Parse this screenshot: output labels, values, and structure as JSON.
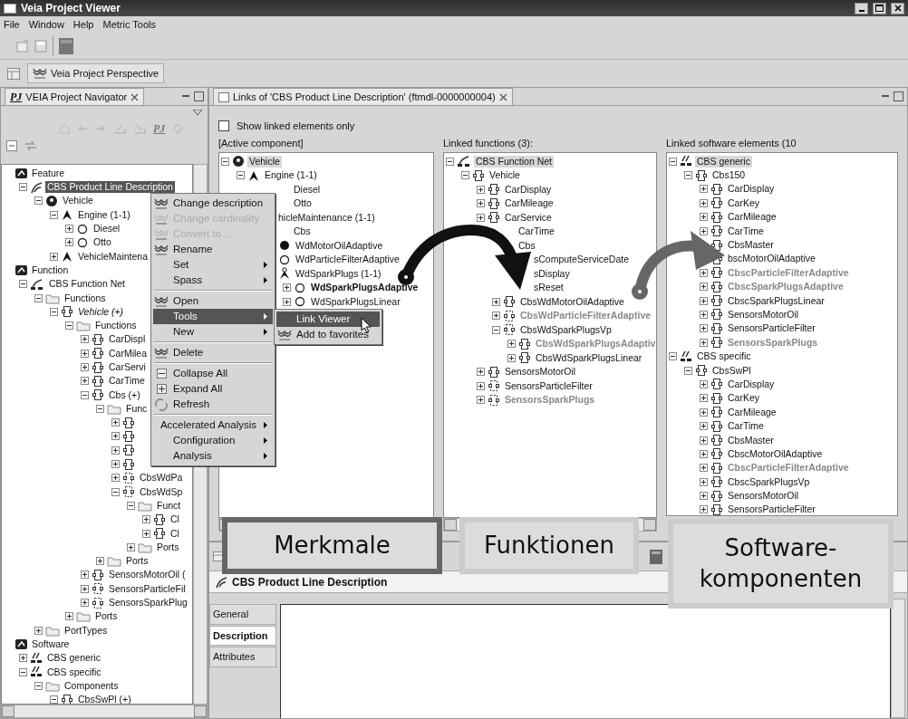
{
  "window": {
    "title": "Veia Project Viewer"
  },
  "menu_bar": [
    "File",
    "Window",
    "Help",
    "Metric Tools"
  ],
  "perspective": {
    "label": "Veia Project Perspective"
  },
  "navigator": {
    "badge": "PJ",
    "title": "VEIA Project Navigator",
    "toolbar_badge": "PJ",
    "tree": [
      {
        "label": "Feature",
        "kind": "category",
        "children": [
          {
            "label": "CBS Product Line Description",
            "kind": "feature-model",
            "expanded": true,
            "highlighted": true,
            "children": [
              {
                "label": "Vehicle",
                "kind": "root-feature",
                "expanded": true,
                "children": [
                  {
                    "label": "Engine (1-1)",
                    "kind": "feature",
                    "expanded": true,
                    "children": [
                      {
                        "label": "Diesel",
                        "kind": "option-empty",
                        "expanded": false
                      },
                      {
                        "label": "Otto",
                        "kind": "option-empty",
                        "expanded": false
                      }
                    ]
                  },
                  {
                    "label": "VehicleMaintena",
                    "kind": "feature",
                    "expanded": false
                  }
                ]
              }
            ]
          }
        ]
      },
      {
        "label": "Function",
        "kind": "category",
        "children": [
          {
            "label": "CBS Function Net",
            "kind": "function-net",
            "expanded": true,
            "children": [
              {
                "label": "Functions",
                "kind": "folder",
                "expanded": true,
                "children": [
                  {
                    "label": "Vehicle (+)",
                    "kind": "function",
                    "italic": true,
                    "expanded": true,
                    "children": [
                      {
                        "label": "Functions",
                        "kind": "folder",
                        "expanded": true,
                        "children": [
                          {
                            "label": "CarDispl",
                            "kind": "function",
                            "expanded": false
                          },
                          {
                            "label": "CarMilea",
                            "kind": "function",
                            "expanded": false
                          },
                          {
                            "label": "CarServi",
                            "kind": "function",
                            "expanded": false
                          },
                          {
                            "label": "CarTime",
                            "kind": "function",
                            "expanded": false
                          },
                          {
                            "label": "Cbs (+)",
                            "kind": "function",
                            "expanded": true,
                            "children": [
                              {
                                "label": "Func",
                                "kind": "folder",
                                "expanded": true,
                                "children": [
                                  {
                                    "kind": "function",
                                    "expanded": false
                                  },
                                  {
                                    "kind": "function",
                                    "expanded": false
                                  },
                                  {
                                    "kind": "function",
                                    "expanded": false
                                  },
                                  {
                                    "kind": "function",
                                    "expanded": false
                                  },
                                  {
                                    "label": "CbsWdPa",
                                    "kind": "function-dashed",
                                    "expanded": false
                                  },
                                  {
                                    "label": "CbsWdSp",
                                    "kind": "function-dashed",
                                    "expanded": true,
                                    "children": [
                                      {
                                        "label": "Funct",
                                        "kind": "folder",
                                        "expanded": true,
                                        "children": [
                                          {
                                            "label": "Cl",
                                            "kind": "function",
                                            "expanded": false
                                          },
                                          {
                                            "label": "Cl",
                                            "kind": "function",
                                            "expanded": false
                                          }
                                        ]
                                      },
                                      {
                                        "label": "Ports",
                                        "kind": "folder",
                                        "expanded": false
                                      }
                                    ]
                                  }
                                ]
                              },
                              {
                                "label": "Ports",
                                "kind": "folder",
                                "expanded": false
                              }
                            ]
                          },
                          {
                            "label": "SensorsMotorOil (",
                            "kind": "function",
                            "expanded": false
                          },
                          {
                            "label": "SensorsParticleFil",
                            "kind": "function-dashed",
                            "expanded": false
                          },
                          {
                            "label": "SensorsSparkPlug",
                            "kind": "function-dashed",
                            "expanded": false
                          }
                        ]
                      },
                      {
                        "label": "Ports",
                        "kind": "folder",
                        "expanded": false
                      }
                    ]
                  }
                ]
              },
              {
                "label": "PortTypes",
                "kind": "folder",
                "expanded": false
              }
            ]
          }
        ]
      },
      {
        "label": "Software",
        "kind": "category",
        "children": [
          {
            "label": "CBS generic",
            "kind": "software",
            "expanded": false
          },
          {
            "label": "CBS specific",
            "kind": "software",
            "expanded": true,
            "children": [
              {
                "label": "Components",
                "kind": "folder",
                "expanded": true,
                "children": [
                  {
                    "label": "CbsSwPl (+)",
                    "kind": "function",
                    "expanded": true
                  }
                ]
              }
            ]
          }
        ]
      }
    ]
  },
  "links_view": {
    "title": "Links of 'CBS Product Line Description' (ftmdl-0000000004)",
    "show_linked_only": {
      "label": "Show linked elements only",
      "checked": false
    },
    "panes": [
      {
        "heading": "[Active component]",
        "tree": [
          {
            "label": "Vehicle",
            "kind": "root-feature",
            "expanded": true,
            "highlighted": true,
            "children": [
              {
                "label": "Engine (1-1)",
                "kind": "feature",
                "expanded": true,
                "children": [
                  {
                    "label": "Diesel",
                    "kind": "covered"
                  },
                  {
                    "label": "Otto",
                    "kind": "covered"
                  }
                ]
              },
              {
                "label": "hicleMaintenance (1-1)",
                "kind": "covered",
                "children": [
                  {
                    "label": "Cbs",
                    "kind": "covered",
                    "children": [
                      {
                        "label": "WdMotorOilAdaptive",
                        "kind": "option-filled"
                      },
                      {
                        "label": "WdParticleFilterAdaptive",
                        "kind": "option-empty"
                      },
                      {
                        "label": "WdSparkPlugs (1-1)",
                        "kind": "feature-alt",
                        "children": [
                          {
                            "label": "WdSparkPlugsAdaptive",
                            "kind": "option-empty",
                            "bold": true,
                            "expanded": false
                          },
                          {
                            "label": "WdSparkPlugsLinear",
                            "kind": "option-empty",
                            "expanded": false
                          }
                        ]
                      }
                    ]
                  }
                ]
              }
            ]
          }
        ]
      },
      {
        "heading": "Linked functions (3):",
        "tree": [
          {
            "label": "CBS Function Net",
            "kind": "function-net",
            "expanded": true,
            "highlighted": true,
            "children": [
              {
                "label": "Vehicle",
                "kind": "function",
                "expanded": true,
                "children": [
                  {
                    "label": "CarDisplay",
                    "kind": "function",
                    "expanded": false
                  },
                  {
                    "label": "CarMileage",
                    "kind": "function",
                    "expanded": false
                  },
                  {
                    "label": "CarService",
                    "kind": "function",
                    "expanded": false
                  },
                  {
                    "label": "CarTime",
                    "kind": "covered"
                  },
                  {
                    "label": "Cbs",
                    "kind": "covered",
                    "children": [
                      {
                        "label": "sComputeServiceDate",
                        "kind": "covered"
                      },
                      {
                        "label": "sDisplay",
                        "kind": "covered"
                      },
                      {
                        "label": "sReset",
                        "kind": "covered"
                      },
                      {
                        "label": "CbsWdMotorOilAdaptive",
                        "kind": "function",
                        "expanded": false
                      },
                      {
                        "label": "CbsWdParticleFilterAdaptive",
                        "kind": "function-dashed",
                        "bold": true,
                        "dimmed": true,
                        "expanded": false
                      },
                      {
                        "label": "CbsWdSparkPlugsVp",
                        "kind": "function-dashed",
                        "expanded": true,
                        "children": [
                          {
                            "label": "CbsWdSparkPlugsAdaptiv",
                            "kind": "function",
                            "bold": true,
                            "dimmed": true,
                            "expanded": false
                          },
                          {
                            "label": "CbsWdSparkPlugsLinear",
                            "kind": "function",
                            "expanded": false
                          }
                        ]
                      }
                    ]
                  },
                  {
                    "label": "SensorsMotorOil",
                    "kind": "function",
                    "expanded": false
                  },
                  {
                    "label": "SensorsParticleFilter",
                    "kind": "function-dashed",
                    "expanded": false
                  },
                  {
                    "label": "SensorsSparkPlugs",
                    "kind": "function-dashed",
                    "bold": true,
                    "dimmed": true,
                    "expanded": false
                  }
                ]
              }
            ]
          }
        ]
      },
      {
        "heading": "Linked software elements (10",
        "tree": [
          {
            "label": "CBS generic",
            "kind": "software",
            "expanded": true,
            "highlighted": true,
            "children": [
              {
                "label": "Cbs150",
                "kind": "function",
                "expanded": true,
                "children": [
                  {
                    "label": "CarDisplay",
                    "kind": "function",
                    "expanded": false
                  },
                  {
                    "label": "CarKey",
                    "kind": "function",
                    "expanded": false
                  },
                  {
                    "label": "CarMileage",
                    "kind": "function",
                    "expanded": false
                  },
                  {
                    "label": "CarTime",
                    "kind": "function",
                    "expanded": false
                  },
                  {
                    "label": "CbsMaster",
                    "kind": "function"
                  },
                  {
                    "label": "bscMotorOilAdaptive",
                    "kind": "function"
                  },
                  {
                    "label": "CbscParticleFilterAdaptive",
                    "kind": "function",
                    "bold": true,
                    "dimmed": true,
                    "expanded": false
                  },
                  {
                    "label": "CbscSparkPlugsAdaptive",
                    "kind": "function",
                    "bold": true,
                    "dimmed": true,
                    "expanded": false
                  },
                  {
                    "label": "CbscSparkPlugsLinear",
                    "kind": "function",
                    "expanded": false
                  },
                  {
                    "label": "SensorsMotorOil",
                    "kind": "function",
                    "expanded": false
                  },
                  {
                    "label": "SensorsParticleFilter",
                    "kind": "function",
                    "expanded": false
                  },
                  {
                    "label": "SensorsSparkPlugs",
                    "kind": "function",
                    "bold": true,
                    "dimmed": true,
                    "expanded": false
                  }
                ]
              }
            ]
          },
          {
            "label": "CBS specific",
            "kind": "software",
            "expanded": true,
            "children": [
              {
                "label": "CbsSwPl",
                "kind": "function",
                "expanded": true,
                "children": [
                  {
                    "label": "CarDisplay",
                    "kind": "function",
                    "expanded": false
                  },
                  {
                    "label": "CarKey",
                    "kind": "function",
                    "expanded": false
                  },
                  {
                    "label": "CarMileage",
                    "kind": "function",
                    "expanded": false
                  },
                  {
                    "label": "CarTime",
                    "kind": "function",
                    "expanded": false
                  },
                  {
                    "label": "CbsMaster",
                    "kind": "function",
                    "expanded": false
                  },
                  {
                    "label": "CbscMotorOilAdaptive",
                    "kind": "function",
                    "expanded": false
                  },
                  {
                    "label": "CbscParticleFilterAdaptive",
                    "kind": "function",
                    "bold": true,
                    "dimmed": true,
                    "expanded": false
                  },
                  {
                    "label": "CbscSparkPlugsVp",
                    "kind": "function",
                    "expanded": false
                  },
                  {
                    "label": "SensorsMotorOil",
                    "kind": "function",
                    "expanded": false
                  },
                  {
                    "label": "SensorsParticleFilter",
                    "kind": "function",
                    "expanded": false
                  }
                ]
              }
            ]
          }
        ]
      }
    ]
  },
  "properties": {
    "title": "CBS Product Line Description",
    "tabs": [
      {
        "label": "General",
        "selected": false
      },
      {
        "label": "Description",
        "selected": true
      },
      {
        "label": "Attributes",
        "selected": false
      }
    ]
  },
  "context_menu": {
    "items": [
      {
        "kind": "veia-item",
        "label": "Change description",
        "disabled": false
      },
      {
        "kind": "veia-item",
        "label": "Change cardinality",
        "disabled": true
      },
      {
        "kind": "veia-item",
        "label": "Convert to ...",
        "disabled": true
      },
      {
        "kind": "veia-item",
        "label": "Rename",
        "disabled": false
      },
      {
        "kind": "plain-item",
        "label": "Set",
        "submenu": true,
        "disabled": false
      },
      {
        "kind": "plain-item",
        "label": "Spass",
        "submenu": true,
        "disabled": false
      },
      {
        "kind": "separator"
      },
      {
        "kind": "veia-item",
        "label": "Open",
        "disabled": false
      },
      {
        "kind": "plain-item",
        "label": "Tools",
        "submenu": true,
        "selected": true,
        "disabled": false
      },
      {
        "kind": "plain-item",
        "label": "New",
        "submenu": true,
        "disabled": false
      },
      {
        "kind": "separator"
      },
      {
        "kind": "veia-item",
        "label": "Delete",
        "disabled": false
      },
      {
        "kind": "separator"
      },
      {
        "kind": "collapse-item",
        "label": "Collapse All",
        "disabled": false
      },
      {
        "kind": "expand-item",
        "label": "Expand All",
        "disabled": false
      },
      {
        "kind": "refresh-item",
        "label": "Refresh",
        "disabled": false
      },
      {
        "kind": "separator"
      },
      {
        "kind": "plain-item",
        "label": "Accelerated Analysis",
        "submenu": true,
        "disabled": false
      },
      {
        "kind": "plain-item",
        "label": "Configuration",
        "submenu": true,
        "disabled": false
      },
      {
        "kind": "plain-item",
        "label": "Analysis",
        "submenu": true,
        "disabled": false
      }
    ]
  },
  "submenu": {
    "items": [
      {
        "kind": "plain-item",
        "label": "Link Viewer",
        "selected": true,
        "disabled": false
      },
      {
        "kind": "veia-item",
        "label": "Add to favorites",
        "disabled": false
      }
    ]
  },
  "callouts": [
    {
      "text": "Merkmale",
      "color": "#666666"
    },
    {
      "text": "Funktionen",
      "color": "#cccccc"
    },
    {
      "text": "Software-\nkomponenten",
      "color": "#cccccc"
    }
  ]
}
